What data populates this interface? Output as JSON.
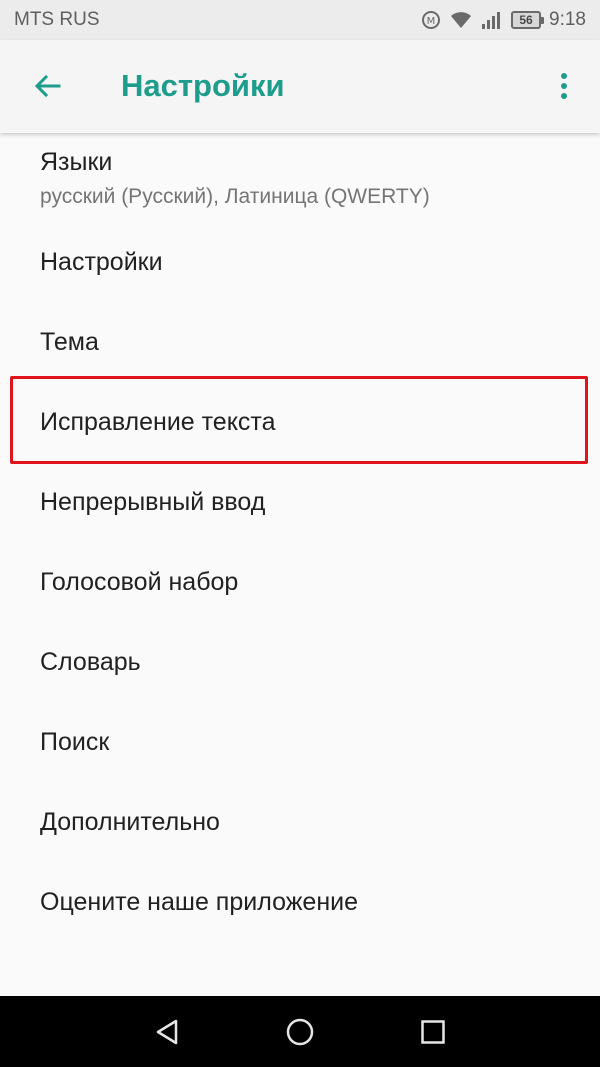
{
  "status_bar": {
    "carrier": "MTS RUS",
    "battery_level": "56",
    "time": "9:18",
    "icons": [
      "data-saver-icon",
      "wifi-icon",
      "signal-icon",
      "battery-icon"
    ]
  },
  "app_bar": {
    "title": "Настройки",
    "back_icon": "arrow-left-icon",
    "menu_icon": "more-vert-icon",
    "accent_color": "#1e9c8c"
  },
  "settings": {
    "items": [
      {
        "label": "Языки",
        "subtitle": "русский (Русский), Латиница (QWERTY)"
      },
      {
        "label": "Настройки"
      },
      {
        "label": "Тема"
      },
      {
        "label": "Исправление текста",
        "highlighted": true
      },
      {
        "label": "Непрерывный ввод"
      },
      {
        "label": "Голосовой набор"
      },
      {
        "label": "Словарь"
      },
      {
        "label": "Поиск"
      },
      {
        "label": "Дополнительно"
      },
      {
        "label": "Оцените наше приложение"
      }
    ]
  },
  "nav_bar": {
    "buttons": [
      "back-triangle-icon",
      "home-circle-icon",
      "recents-square-icon"
    ]
  },
  "colors": {
    "highlight_border": "#e0141c",
    "background": "#fafafa"
  }
}
